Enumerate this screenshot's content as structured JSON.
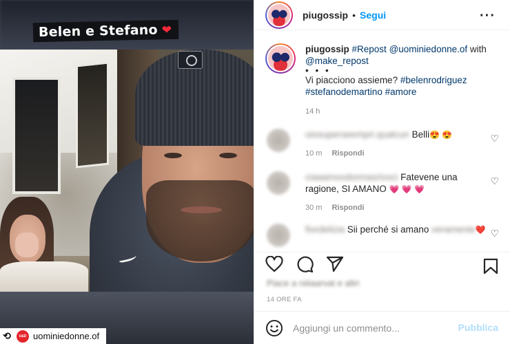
{
  "media": {
    "sticker_text": "Belen e Stefano",
    "sticker_icon": "red-heart-icon",
    "repost_user": "uominiedonne.of"
  },
  "header": {
    "username": "piugossip",
    "separator": "•",
    "follow_label": "Segui",
    "more_icon": "more-options-icon"
  },
  "caption": {
    "username": "piugossip",
    "repost_tag": "#Repost",
    "repost_source": "@uominiedonne.of",
    "with_text": "with",
    "with_user": "@make_repost",
    "dots": "• • •",
    "question": "Vi piacciono assieme?",
    "hashtags": [
      "#belenrodriguez",
      "#stefanodemartino",
      "#amore"
    ],
    "time": "14 h"
  },
  "comments": [
    {
      "user_blurred": "oiosuperseempri.qualcun",
      "text": "Belli",
      "emojis": "😍 😍",
      "time": "10 m",
      "reply_label": "Rispondi"
    },
    {
      "user_blurred": "ciaaamoodonnasrivoci",
      "text": "Fatevene una ragione, SI AMANO",
      "emojis": "💗 💗 💗",
      "time": "30 m",
      "reply_label": "Rispondi"
    },
    {
      "user_blurred": "fiordelizia",
      "text": "Sii perché si amano",
      "text_blurred": "veramente",
      "emojis": "❤️"
    }
  ],
  "actions": {
    "like_icon": "heart-outline-icon",
    "comment_icon": "comment-icon",
    "share_icon": "paper-plane-icon",
    "save_icon": "bookmark-icon"
  },
  "likes_text": "Piace a niiiaarvat e altri",
  "time_ago": "14 ORE FA",
  "add_comment": {
    "placeholder": "Aggiungi un commento...",
    "post_label": "Pubblica",
    "emoji_icon": "smiley-icon"
  },
  "colors": {
    "accent_blue": "#0095f6",
    "disabled_blue": "#b2dffc",
    "link_blue": "#00376b",
    "heart_red": "#ff2a3b"
  }
}
